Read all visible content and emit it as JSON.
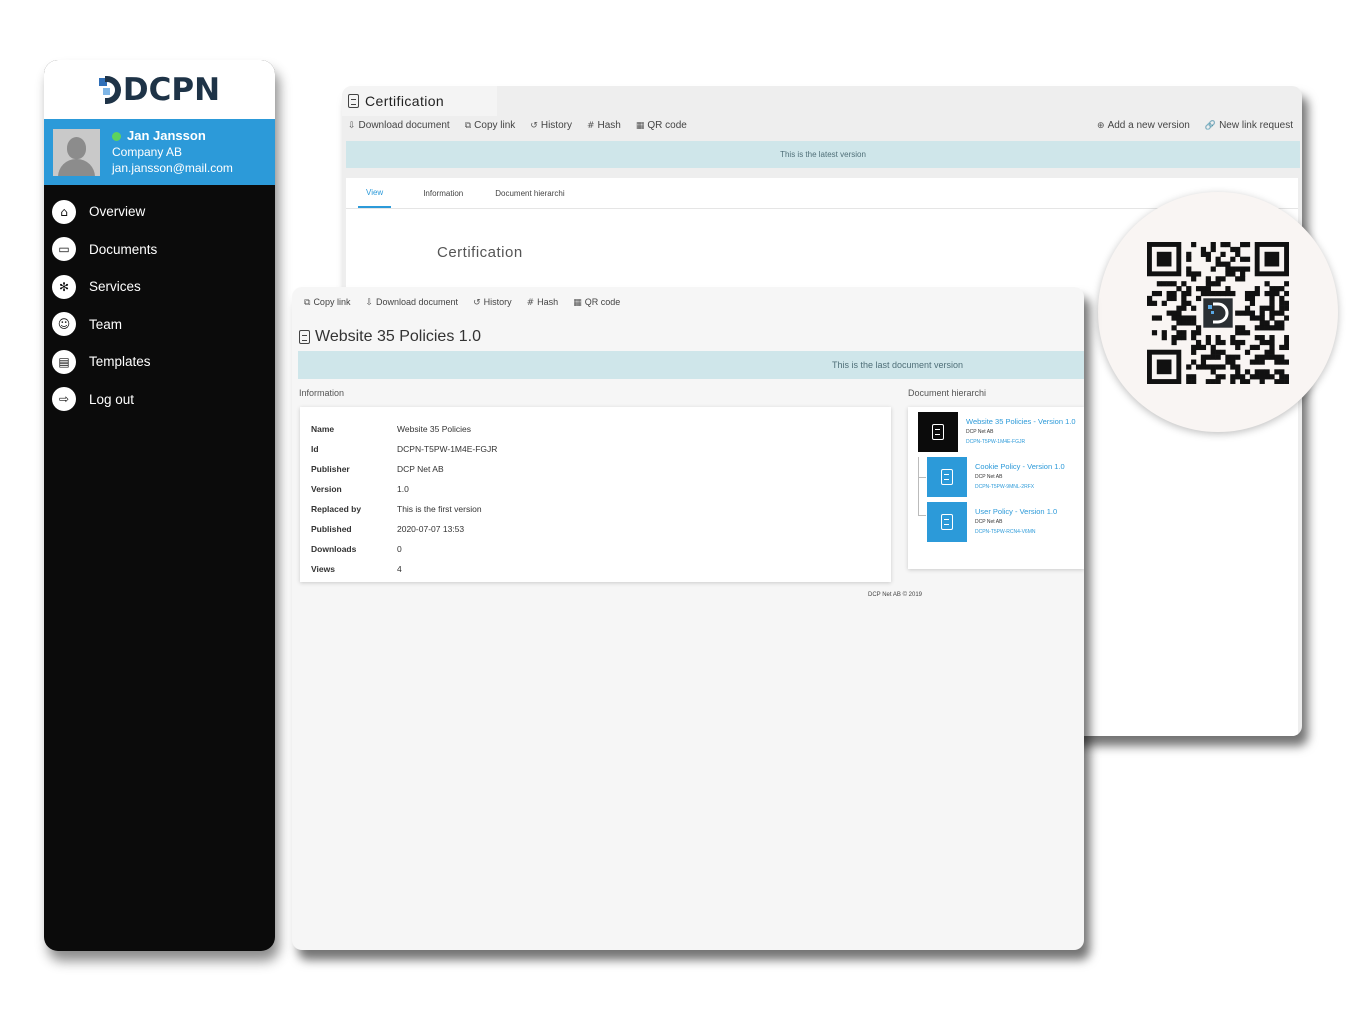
{
  "sidebar": {
    "logo_text": "DCPN",
    "user": {
      "name": "Jan Jansson",
      "company": "Company AB",
      "email": "jan.jansson@mail.com"
    },
    "nav": [
      {
        "label": "Overview",
        "icon": "home-icon"
      },
      {
        "label": "Documents",
        "icon": "folder-icon"
      },
      {
        "label": "Services",
        "icon": "network-icon"
      },
      {
        "label": "Team",
        "icon": "team-icon"
      },
      {
        "label": "Templates",
        "icon": "template-icon"
      },
      {
        "label": "Log out",
        "icon": "logout-icon"
      }
    ]
  },
  "back_window": {
    "tab_title": "Certification",
    "toolbar": [
      "Download document",
      "Copy link",
      "History",
      "Hash",
      "QR code"
    ],
    "toolbar_right": [
      "Add a new version",
      "New link request"
    ],
    "banner": "This is the latest version",
    "tabs": [
      "View",
      "Information",
      "Document hierarchi"
    ],
    "heading": "Certification"
  },
  "front_window": {
    "toolbar": [
      "Copy link",
      "Download document",
      "History",
      "Hash",
      "QR code"
    ],
    "title": "Website 35 Policies 1.0",
    "banner": "This is the last document version",
    "info_label": "Information",
    "hierarchy_label": "Document hierarchi",
    "info": [
      {
        "key": "Name",
        "value": "Website 35 Policies"
      },
      {
        "key": "Id",
        "value": "DCPN-T5PW-1M4E-FGJR"
      },
      {
        "key": "Publisher",
        "value": "DCP Net AB"
      },
      {
        "key": "Version",
        "value": "1.0"
      },
      {
        "key": "Replaced by",
        "value": "This is the first version"
      },
      {
        "key": "Published",
        "value": "2020-07-07 13:53"
      },
      {
        "key": "Downloads",
        "value": "0"
      },
      {
        "key": "Views",
        "value": "4"
      }
    ],
    "hierarchy": [
      {
        "title": "Website 35 Policies - Version 1.0",
        "publisher": "DCP Net AB",
        "id": "DCPN-T5PW-1M4E-FGJR",
        "color": "#0b0b0b"
      },
      {
        "title": "Cookie Policy - Version 1.0",
        "publisher": "DCP Net AB",
        "id": "DCPN-T5PW-9MNL-2RFX",
        "color": "#2c9ad9"
      },
      {
        "title": "User Policy - Version 1.0",
        "publisher": "DCP Net AB",
        "id": "DCPN-T5PW-RCN4-V6MN",
        "color": "#2c9ad9"
      }
    ],
    "footer": "DCP Net AB © 2019"
  },
  "colors": {
    "accent": "#2c9ad9",
    "sidebar_bg": "#0b0b0b",
    "banner_bg": "#cfe6ea",
    "online": "#5dd35d"
  }
}
